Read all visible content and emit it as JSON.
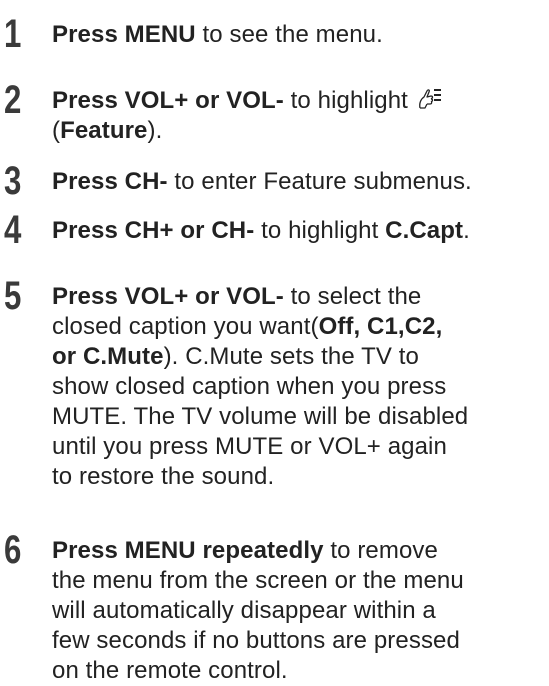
{
  "steps": [
    {
      "num": "1",
      "bold": "Press MENU",
      "text": " to see the menu."
    },
    {
      "num": "2",
      "bold": "Press VOL+ or VOL-",
      "text": " to highlight ",
      "line2_a": "(",
      "line2_bold": "Feature",
      "line2_b": ")."
    },
    {
      "num": "3",
      "bold": "Press CH-",
      "text": " to enter Feature submenus."
    },
    {
      "num": "4",
      "bold": "Press CH+ or CH-",
      "text": " to highlight ",
      "bold2": "C.Capt",
      "end": "."
    },
    {
      "num": "5",
      "bold": "Press VOL+ or VOL-",
      "text": " to select the",
      "l2": "closed caption you want(",
      "l2_bold": "Off, C1,C2,",
      "l3_bold": "or C.Mute",
      "l3": "). C.Mute sets the TV to",
      "l4": "show closed caption when you press",
      "l5": "MUTE. The TV volume will be disabled",
      "l6": "until you press MUTE or VOL+ again",
      "l7": "to restore the sound."
    },
    {
      "num": "6",
      "bold": "Press MENU repeatedly",
      "text": " to remove",
      "l2": "the menu from the screen or the menu",
      "l3": "will automatically disappear within a",
      "l4": "few seconds if no buttons are pressed",
      "l5": "on the remote control."
    }
  ],
  "icons": {
    "feature": "feature-hand-icon"
  }
}
